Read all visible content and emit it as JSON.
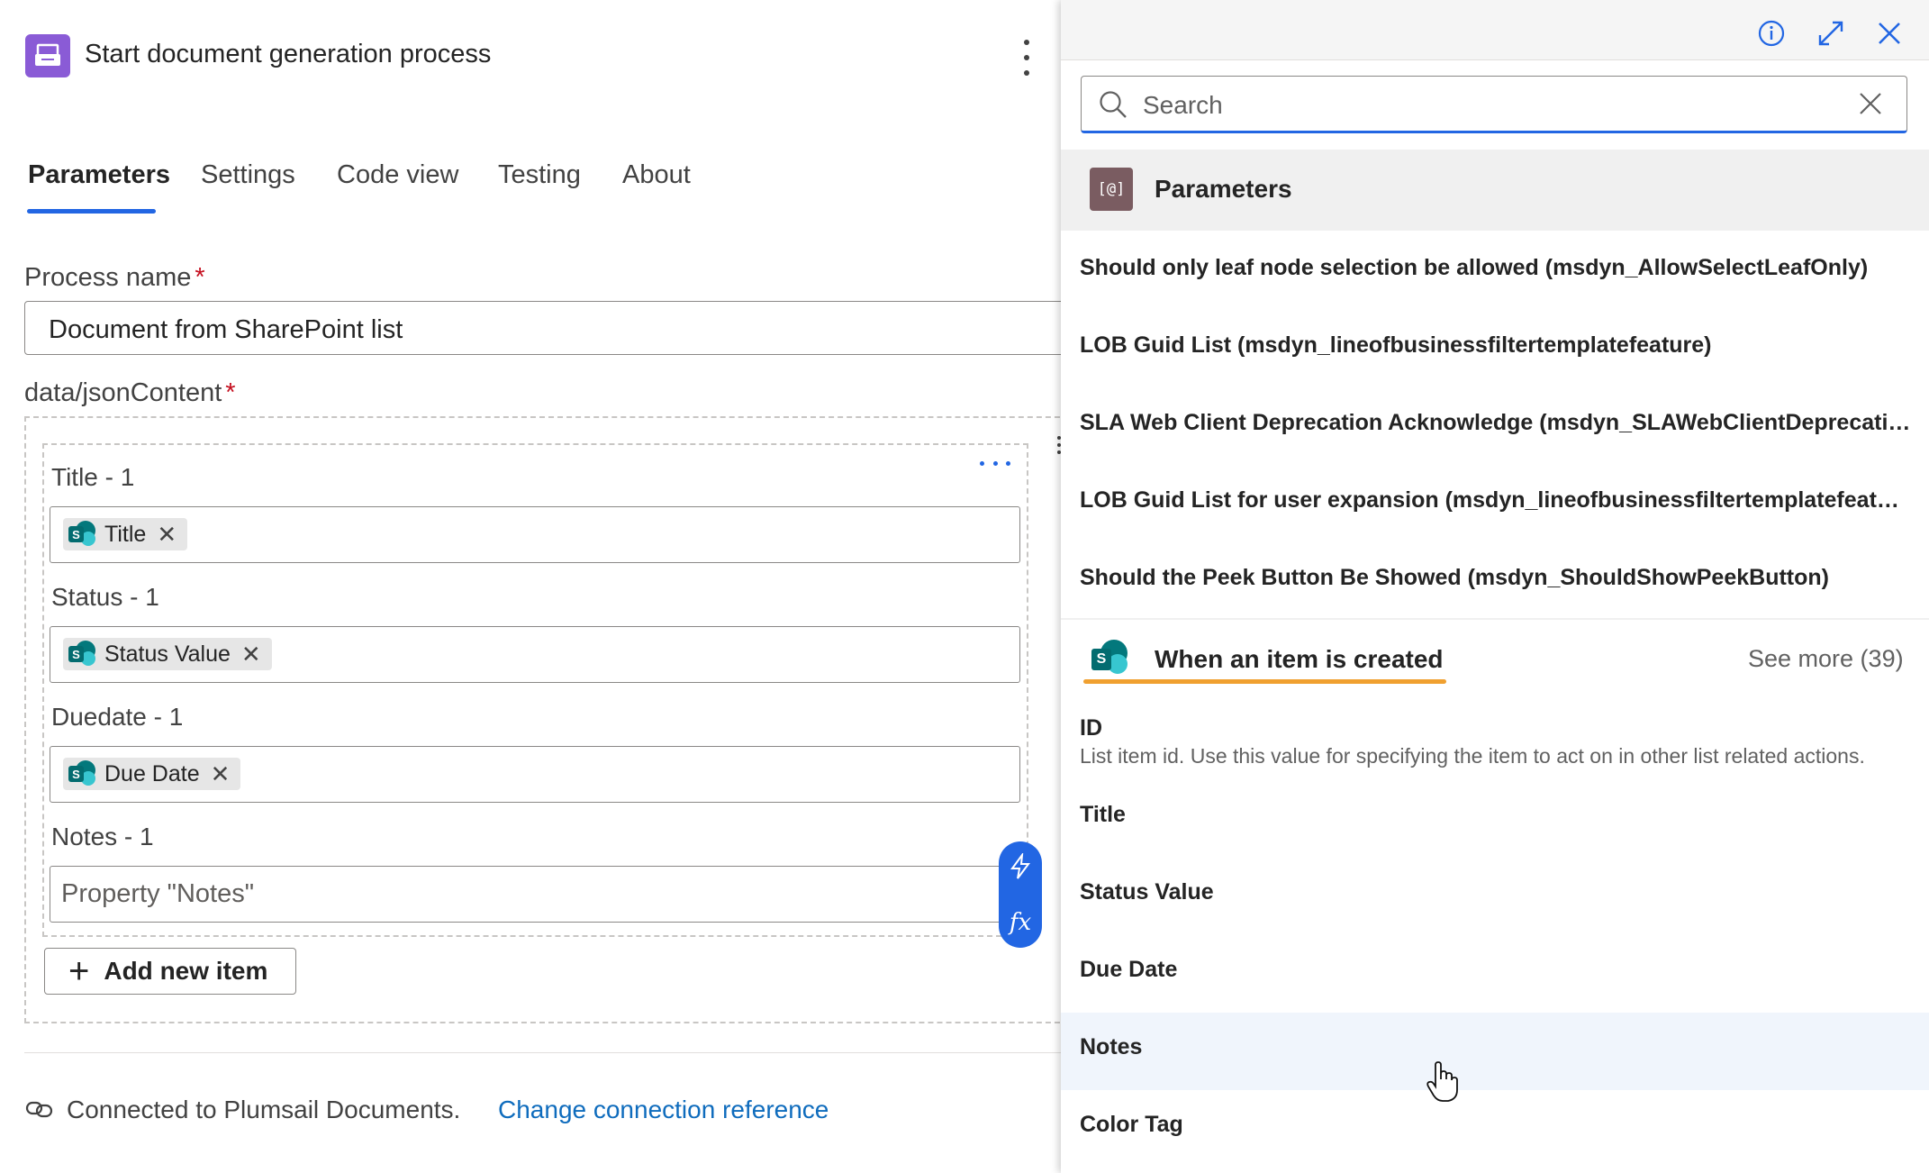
{
  "action": {
    "title": "Start document generation process",
    "icon": "document-generation-icon",
    "icon_color": "#8a5bd6"
  },
  "tabs": [
    {
      "label": "Parameters",
      "active": true
    },
    {
      "label": "Settings"
    },
    {
      "label": "Code view"
    },
    {
      "label": "Testing"
    },
    {
      "label": "About"
    }
  ],
  "fields": {
    "process_name": {
      "label": "Process name",
      "required_mark": "*",
      "value": "Document from SharePoint list"
    },
    "json_content": {
      "label": "data/jsonContent",
      "required_mark": "*"
    }
  },
  "items": [
    {
      "label": "Title - 1",
      "token": "Title"
    },
    {
      "label": "Status - 1",
      "token": "Status Value"
    },
    {
      "label": "Duedate - 1",
      "token": "Due Date"
    },
    {
      "label": "Notes - 1",
      "placeholder": "Property \"Notes\""
    }
  ],
  "add_item_label": "Add new item",
  "connection": {
    "text": "Connected to Plumsail Documents.",
    "link": "Change connection reference"
  },
  "panel": {
    "search_placeholder": "Search",
    "parameters_section": {
      "title": "Parameters",
      "icon_text": "[@]",
      "items": [
        "Should only leaf node selection be allowed (msdyn_AllowSelectLeafOnly)",
        "LOB Guid List (msdyn_lineofbusinessfiltertemplatefeature)",
        "SLA Web Client Deprecation Acknowledge (msdyn_SLAWebClientDeprecationAcknowledge)",
        "LOB Guid List for user expansion (msdyn_lineofbusinessfiltertemplatefeatureuserexpansion)",
        "Should the Peek Button Be Showed (msdyn_ShouldShowPeekButton)"
      ]
    },
    "trigger_section": {
      "title": "When an item is created",
      "see_more": "See more (39)",
      "accent": "#f0a030",
      "id_title": "ID",
      "id_desc": "List item id. Use this value for specifying the item to act on in other list related actions.",
      "items": [
        "Title",
        "Status Value",
        "Due Date",
        "Notes",
        "Color Tag"
      ]
    }
  },
  "colors": {
    "accent_blue": "#2266e3",
    "link": "#0f6cbd",
    "required": "#c50f1f"
  }
}
